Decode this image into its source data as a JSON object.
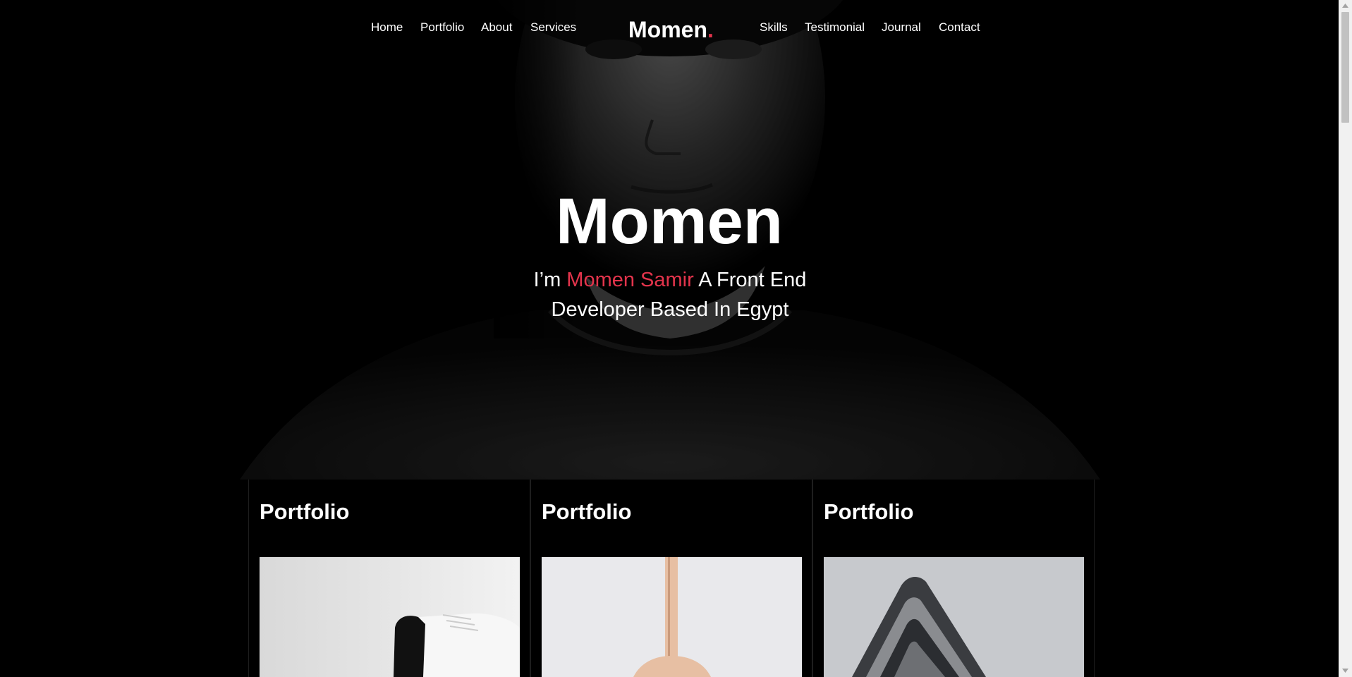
{
  "nav": {
    "left_links": [
      "Home",
      "Portfolio",
      "About",
      "Services"
    ],
    "right_links": [
      "Skills",
      "Testimonial",
      "Journal",
      "Contact"
    ],
    "logo_text": "Momen",
    "logo_dot": ".",
    "accent_color": "#e3344c"
  },
  "hero": {
    "title": "Momen",
    "subtitle_prefix": "I’m ",
    "subtitle_name": "Momen Samir",
    "subtitle_suffix": " A Front End Developer Based In Egypt",
    "background": "black-and-white portrait photo"
  },
  "cards": [
    {
      "title": "Portfolio",
      "image": "sneaker-photo"
    },
    {
      "title": "Portfolio",
      "image": "bag-photo"
    },
    {
      "title": "Portfolio",
      "image": "building-photo"
    }
  ]
}
